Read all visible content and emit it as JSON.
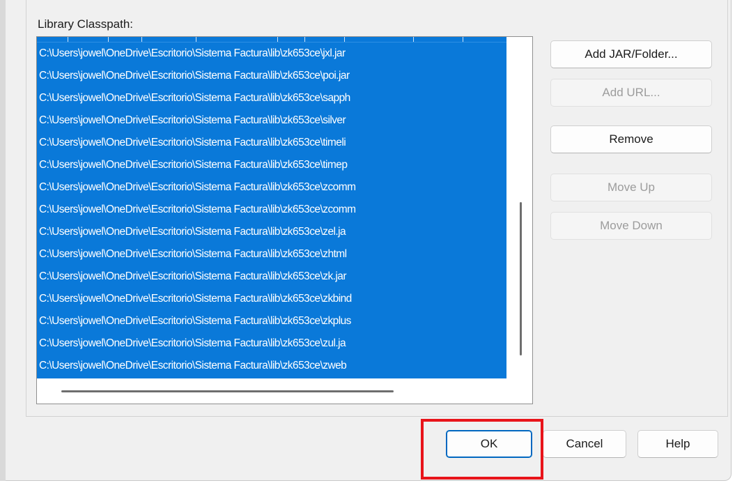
{
  "library": {
    "label": "Library Classpath:",
    "entries": [
      "C:\\Users\\jowel\\OneDrive\\Escritorio\\Sistema Factura\\lib\\zk653ce\\jxl.jar",
      "C:\\Users\\jowel\\OneDrive\\Escritorio\\Sistema Factura\\lib\\zk653ce\\poi.jar",
      "C:\\Users\\jowel\\OneDrive\\Escritorio\\Sistema Factura\\lib\\zk653ce\\sapph",
      "C:\\Users\\jowel\\OneDrive\\Escritorio\\Sistema Factura\\lib\\zk653ce\\silver",
      "C:\\Users\\jowel\\OneDrive\\Escritorio\\Sistema Factura\\lib\\zk653ce\\timeli",
      "C:\\Users\\jowel\\OneDrive\\Escritorio\\Sistema Factura\\lib\\zk653ce\\timep",
      "C:\\Users\\jowel\\OneDrive\\Escritorio\\Sistema Factura\\lib\\zk653ce\\zcomm",
      "C:\\Users\\jowel\\OneDrive\\Escritorio\\Sistema Factura\\lib\\zk653ce\\zcomm",
      "C:\\Users\\jowel\\OneDrive\\Escritorio\\Sistema Factura\\lib\\zk653ce\\zel.ja",
      "C:\\Users\\jowel\\OneDrive\\Escritorio\\Sistema Factura\\lib\\zk653ce\\zhtml",
      "C:\\Users\\jowel\\OneDrive\\Escritorio\\Sistema Factura\\lib\\zk653ce\\zk.jar",
      "C:\\Users\\jowel\\OneDrive\\Escritorio\\Sistema Factura\\lib\\zk653ce\\zkbind",
      "C:\\Users\\jowel\\OneDrive\\Escritorio\\Sistema Factura\\lib\\zk653ce\\zkplus",
      "C:\\Users\\jowel\\OneDrive\\Escritorio\\Sistema Factura\\lib\\zk653ce\\zul.ja",
      "C:\\Users\\jowel\\OneDrive\\Escritorio\\Sistema Factura\\lib\\zk653ce\\zweb"
    ]
  },
  "buttons": {
    "add_jar": "Add JAR/Folder...",
    "add_url": "Add URL...",
    "remove": "Remove",
    "move_up": "Move Up",
    "move_down": "Move Down"
  },
  "footer": {
    "ok": "OK",
    "cancel": "Cancel",
    "help": "Help"
  },
  "colors": {
    "selection": "#0a79d9",
    "highlight": "#e8141a",
    "default_button_border": "#0067c0"
  }
}
